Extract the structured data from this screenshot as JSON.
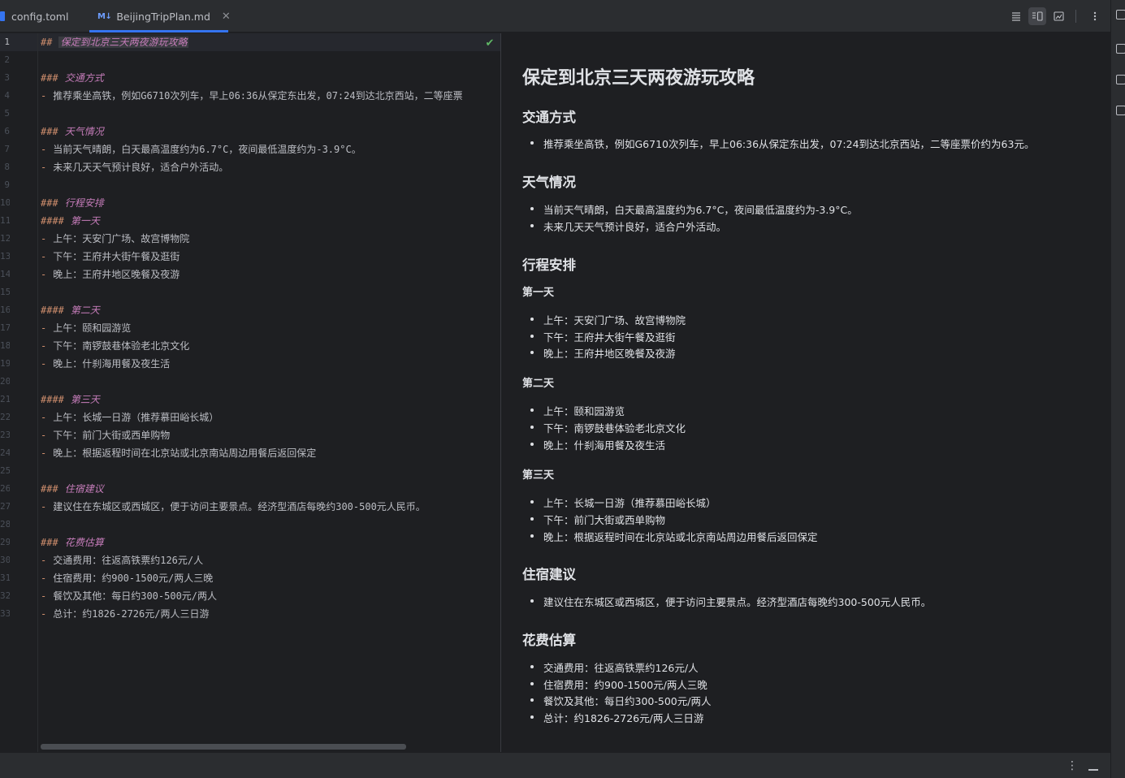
{
  "tabs": [
    {
      "label": "config.toml",
      "active": false
    },
    {
      "label": "BeijingTripPlan.md",
      "badge": "M↓",
      "active": true
    }
  ],
  "toolbar": {
    "editor_only_icon": "lines-icon",
    "split_icon": "split-editor-preview-icon",
    "preview_only_icon": "preview-icon",
    "more_icon": "more-vertical-icon"
  },
  "editor": {
    "line_numbers": [
      "1",
      "2",
      "3",
      "4",
      "5",
      "6",
      "7",
      "8",
      "9",
      "10",
      "11",
      "12",
      "13",
      "14",
      "15",
      "16",
      "17",
      "18",
      "19",
      "20",
      "21",
      "22",
      "23",
      "24",
      "25",
      "26",
      "27",
      "28",
      "29",
      "30",
      "31",
      "32",
      "33"
    ],
    "lines": [
      {
        "kind": "h",
        "marker": "##",
        "text": "保定到北京三天两夜游玩攻略"
      },
      {
        "kind": "blank",
        "text": ""
      },
      {
        "kind": "h",
        "marker": "###",
        "text": "交通方式"
      },
      {
        "kind": "li",
        "marker": "-",
        "text": "推荐乘坐高铁，例如G6710次列车，早上06:36从保定东出发，07:24到达北京西站，二等座票"
      },
      {
        "kind": "blank",
        "text": ""
      },
      {
        "kind": "h",
        "marker": "###",
        "text": "天气情况"
      },
      {
        "kind": "li",
        "marker": "-",
        "text": "当前天气晴朗，白天最高温度约为6.7°C，夜间最低温度约为-3.9°C。"
      },
      {
        "kind": "li",
        "marker": "-",
        "text": "未来几天天气预计良好，适合户外活动。"
      },
      {
        "kind": "blank",
        "text": ""
      },
      {
        "kind": "h",
        "marker": "###",
        "text": "行程安排"
      },
      {
        "kind": "h",
        "marker": "####",
        "text": "第一天"
      },
      {
        "kind": "li",
        "marker": "-",
        "text": "上午：天安门广场、故宫博物院"
      },
      {
        "kind": "li",
        "marker": "-",
        "text": "下午：王府井大街午餐及逛街"
      },
      {
        "kind": "li",
        "marker": "-",
        "text": "晚上：王府井地区晚餐及夜游"
      },
      {
        "kind": "blank",
        "text": ""
      },
      {
        "kind": "h",
        "marker": "####",
        "text": "第二天"
      },
      {
        "kind": "li",
        "marker": "-",
        "text": "上午：颐和园游览"
      },
      {
        "kind": "li",
        "marker": "-",
        "text": "下午：南锣鼓巷体验老北京文化"
      },
      {
        "kind": "li",
        "marker": "-",
        "text": "晚上：什刹海用餐及夜生活"
      },
      {
        "kind": "blank",
        "text": ""
      },
      {
        "kind": "h",
        "marker": "####",
        "text": "第三天"
      },
      {
        "kind": "li",
        "marker": "-",
        "text": "上午：长城一日游（推荐慕田峪长城）"
      },
      {
        "kind": "li",
        "marker": "-",
        "text": "下午：前门大街或西单购物"
      },
      {
        "kind": "li",
        "marker": "-",
        "text": "晚上：根据返程时间在北京站或北京南站周边用餐后返回保定"
      },
      {
        "kind": "blank",
        "text": ""
      },
      {
        "kind": "h",
        "marker": "###",
        "text": "住宿建议"
      },
      {
        "kind": "li",
        "marker": "-",
        "text": "建议住在东城区或西城区，便于访问主要景点。经济型酒店每晚约300-500元人民币。"
      },
      {
        "kind": "blank",
        "text": ""
      },
      {
        "kind": "h",
        "marker": "###",
        "text": "花费估算"
      },
      {
        "kind": "li",
        "marker": "-",
        "text": "交通费用：往返高铁票约126元/人"
      },
      {
        "kind": "li",
        "marker": "-",
        "text": "住宿费用：约900-1500元/两人三晚"
      },
      {
        "kind": "li",
        "marker": "-",
        "text": "餐饮及其他：每日约300-500元/两人"
      },
      {
        "kind": "li",
        "marker": "-",
        "text": "总计：约1826-2726元/两人三日游"
      }
    ]
  },
  "preview": {
    "title": "保定到北京三天两夜游玩攻略",
    "sections": {
      "transport": {
        "heading": "交通方式",
        "items": [
          "推荐乘坐高铁，例如G6710次列车，早上06:36从保定东出发，07:24到达北京西站，二等座票价约为63元。"
        ]
      },
      "weather": {
        "heading": "天气情况",
        "items": [
          "当前天气晴朗，白天最高温度约为6.7°C，夜间最低温度约为-3.9°C。",
          "未来几天天气预计良好，适合户外活动。"
        ]
      },
      "itinerary": {
        "heading": "行程安排",
        "day1": {
          "heading": "第一天",
          "items": [
            "上午：天安门广场、故宫博物院",
            "下午：王府井大街午餐及逛街",
            "晚上：王府井地区晚餐及夜游"
          ]
        },
        "day2": {
          "heading": "第二天",
          "items": [
            "上午：颐和园游览",
            "下午：南锣鼓巷体验老北京文化",
            "晚上：什刹海用餐及夜生活"
          ]
        },
        "day3": {
          "heading": "第三天",
          "items": [
            "上午：长城一日游（推荐慕田峪长城）",
            "下午：前门大街或西单购物",
            "晚上：根据返程时间在北京站或北京南站周边用餐后返回保定"
          ]
        }
      },
      "lodging": {
        "heading": "住宿建议",
        "items": [
          "建议住在东城区或西城区，便于访问主要景点。经济型酒店每晚约300-500元人民币。"
        ]
      },
      "cost": {
        "heading": "花费估算",
        "items": [
          "交通费用：往返高铁票约126元/人",
          "住宿费用：约900-1500元/两人三晚",
          "餐饮及其他：每日约300-500元/两人",
          "总计：约1826-2726元/两人三日游"
        ]
      }
    }
  },
  "colors": {
    "accent": "#3574f0",
    "heading_marker": "#cf8e6d",
    "heading_text": "#c77dbb",
    "inspection_ok": "#5fb865"
  }
}
